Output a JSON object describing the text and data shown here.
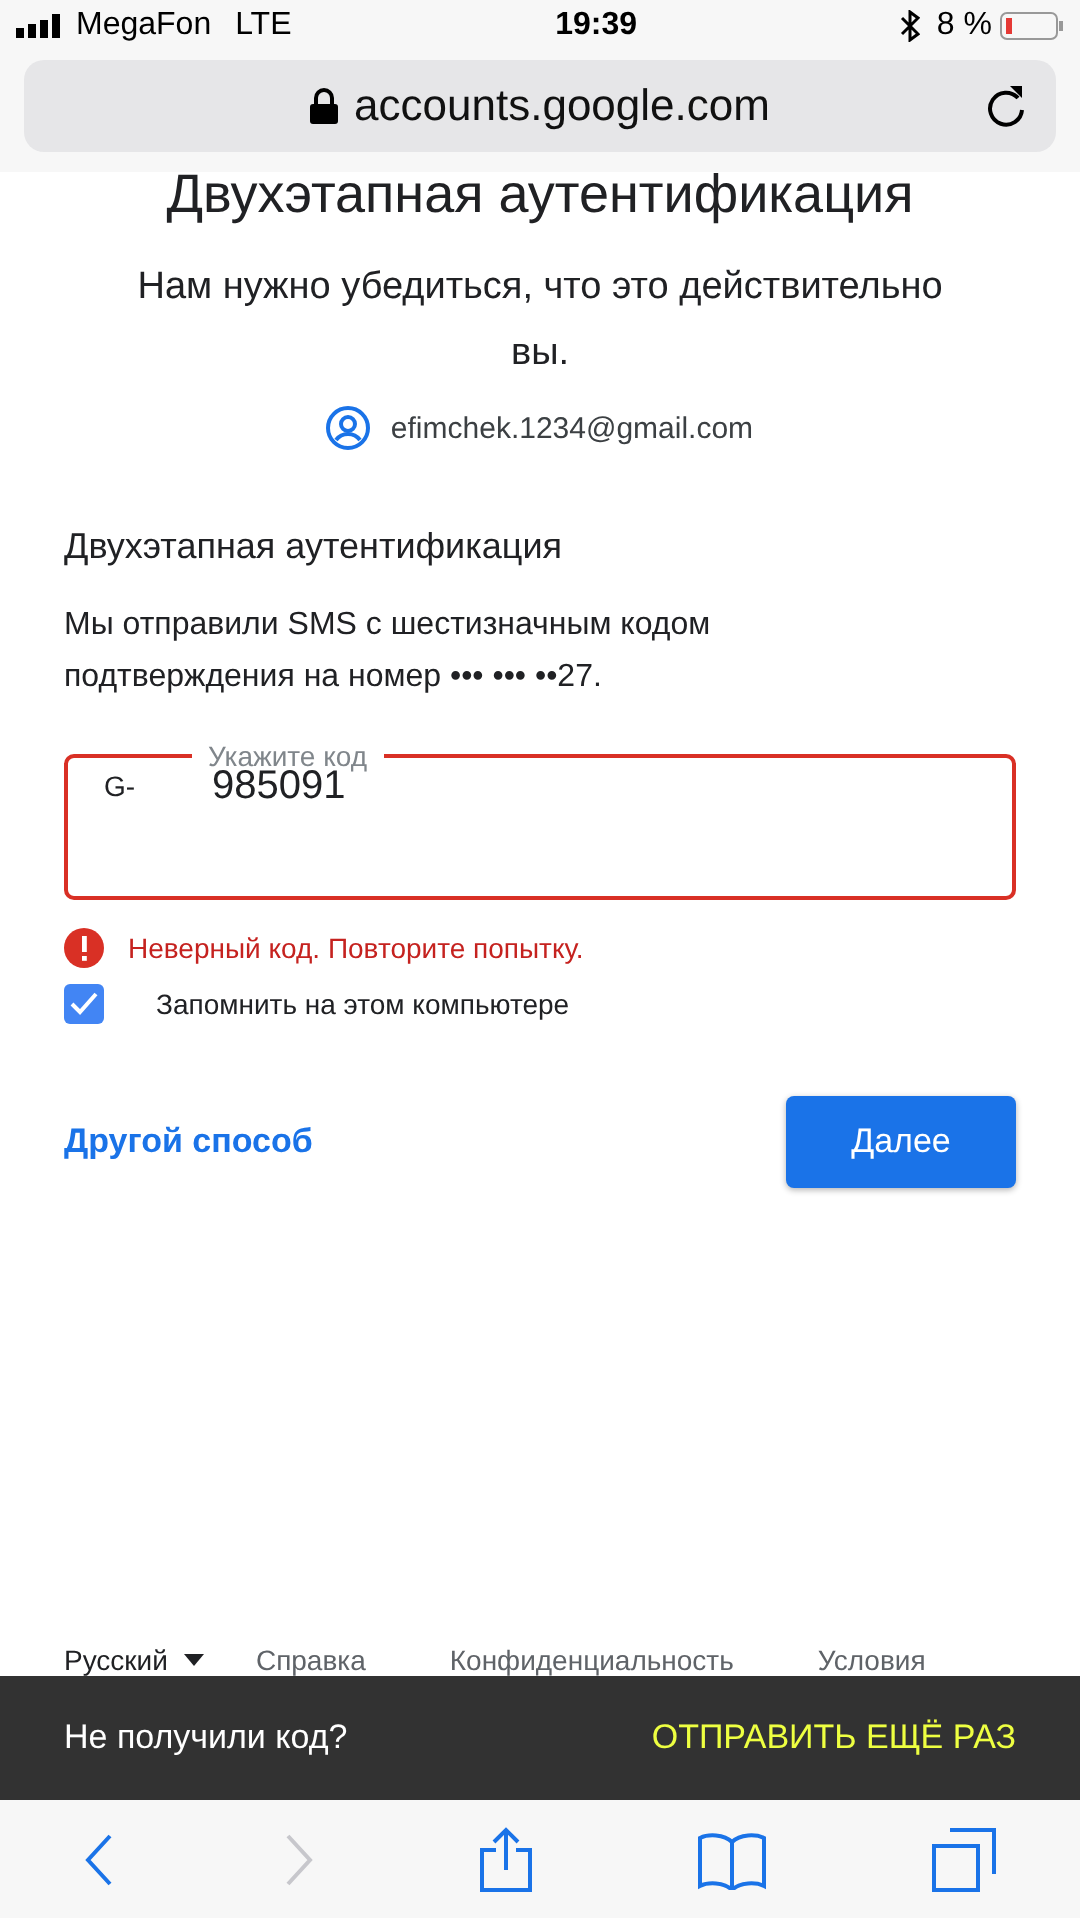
{
  "status_bar": {
    "carrier": "MegaFon",
    "network": "LTE",
    "time": "19:39",
    "battery": "8 %"
  },
  "address_bar": {
    "url": "accounts.google.com"
  },
  "page": {
    "title": "Двухэтапная аутентификация",
    "subtitle": "Нам нужно убедиться, что это действительно вы.",
    "account": "efimchek.1234@gmail.com",
    "section_title": "Двухэтапная аутентификация",
    "message": "Мы отправили SMS с шестизначным кодом подтверждения на номер ••• ••• ••27.",
    "code_field": {
      "label": "Укажите код",
      "prefix": "G-",
      "value": "985091",
      "error": true
    },
    "error": "Неверный код. Повторите попытку.",
    "remember": {
      "label": "Запомнить на этом компьютере",
      "checked": true
    },
    "other_way": "Другой способ",
    "next_button": "Далее"
  },
  "footer": {
    "language": "Русский",
    "links": [
      "Справка",
      "Конфиденциальность",
      "Условия"
    ]
  },
  "snackbar": {
    "message": "Не получили код?",
    "action": "ОТПРАВИТЬ ЕЩЁ РАЗ"
  },
  "toolbar": [
    {
      "kind": "back",
      "disabled": false
    },
    {
      "kind": "forward",
      "disabled": true
    },
    {
      "kind": "share",
      "disabled": false
    },
    {
      "kind": "bookmarks",
      "disabled": false
    },
    {
      "kind": "tabs",
      "disabled": false
    }
  ]
}
